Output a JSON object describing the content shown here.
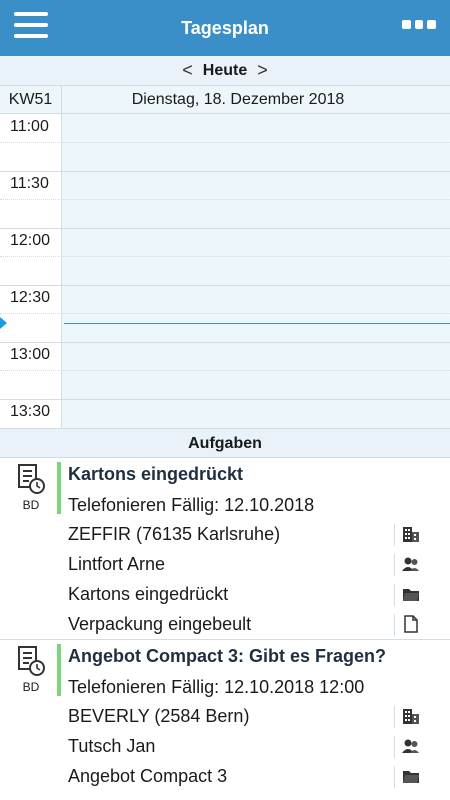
{
  "header": {
    "title": "Tagesplan",
    "menu_icon": "hamburger-menu-icon",
    "more_icon": "more-options-icon"
  },
  "datenav": {
    "prev": "<",
    "today": "Heute",
    "next": ">"
  },
  "calendar": {
    "week": "KW51",
    "day_label": "Dienstag, 18. Dezember 2018",
    "times": [
      "11:00",
      "11:30",
      "12:00",
      "12:30",
      "13:00",
      "13:30"
    ]
  },
  "tasks_header": "Aufgaben",
  "colors": {
    "header": "#3a8fc8",
    "accent_bar": "#7ed47e",
    "panel_bg": "#edf6fa"
  },
  "tasks": [
    {
      "title": "Kartons eingedrückt",
      "subtitle": "Telefonieren Fällig: 12.10.2018",
      "badge": "BD",
      "rows": [
        {
          "text": "ZEFFIR (76135 Karlsruhe)",
          "icon": "company-icon"
        },
        {
          "text": "Lintfort Arne",
          "icon": "contact-icon"
        },
        {
          "text": "Kartons eingedrückt",
          "icon": "folder-icon"
        },
        {
          "text": "Verpackung eingebeult",
          "icon": "document-icon"
        }
      ]
    },
    {
      "title": "Angebot Compact 3: Gibt es Fragen?",
      "subtitle": "Telefonieren Fällig: 12.10.2018 12:00",
      "badge": "BD",
      "rows": [
        {
          "text": "BEVERLY (2584 Bern)",
          "icon": "company-icon"
        },
        {
          "text": "Tutsch Jan",
          "icon": "contact-icon"
        },
        {
          "text": "Angebot Compact 3",
          "icon": "folder-icon"
        }
      ]
    }
  ]
}
